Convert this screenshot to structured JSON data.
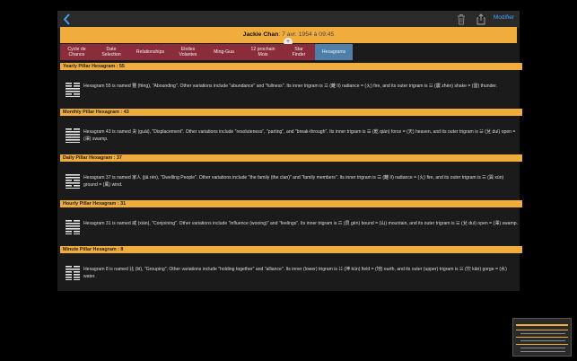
{
  "toolbar": {
    "back_icon": "chevron-left-icon",
    "trash_icon": "trash-icon",
    "share_icon": "share-icon",
    "modifier_label": "Modifier",
    "accent": "#4aa3ff"
  },
  "banner": {
    "name": "Jackie Chan",
    "date": ": 7 avr. 1954 à 09:45",
    "color": "#f0ad3d"
  },
  "plus_label": "+",
  "tabs": [
    {
      "label": "Cycle de\nChance"
    },
    {
      "label": "Date\nSelection"
    },
    {
      "label": "Relationships"
    },
    {
      "label": "Etoiles\nVolantes"
    },
    {
      "label": "Ming-Gua"
    },
    {
      "label": "12 prochain\nMois"
    },
    {
      "label": "Star\nFinder"
    },
    {
      "label": "Hexagrams"
    }
  ],
  "tab_colors": {
    "normal": "#8a2c3a",
    "active": "#4e7fa8"
  },
  "sections": [
    {
      "title": "Yearly Pillar Hexagram : 55",
      "text": "Hexagram 55 is named 豐 (fēng), \"Abounding\". Other variations include \"abundance\" and \"fullness\". Its inner trigram is ☲ (離 lí) radiance = (火) fire, and its outer trigram is ☳ (震 zhèn) shake = (雷) thunder."
    },
    {
      "title": "Monthly Pillar Hexagram : 43",
      "text": "Hexagram 43 is named 夬 (guài), \"Displacement\". Other variations include \"resoluteness\", \"parting\", and \"break-through\". Its inner trigram is ☰ (乾 qián) force = (天) heaven, and its outer trigram is ☱ (兌 duì) open = (澤) swamp."
    },
    {
      "title": "Daily Pillar Hexagram : 37",
      "text": "Hexagram 37 is named 家人 (jiā rén), \"Dwelling People\". Other variations include \"the family (the clan)\" and \"family members\". Its inner trigram is ☲ (離 lí) radiance = (火) fire, and its outer trigram is ☴ (巽 xùn) ground = (風) wind."
    },
    {
      "title": "Hourly Pillar Hexagram : 31",
      "text": "Hexagram 31 is named 咸 (xián), \"Conjoining\". Other variations include \"influence (wooing)\" and \"feelings\". Its inner trigram is ☶ (艮 gèn) bound = (山) mountain, and its outer trigram is ☱ (兌 duì) open = (澤) swamp."
    },
    {
      "title": "Minute Pillar Hexagram : 8",
      "text": "Hexagram 8 is named 比 (bǐ), \"Grouping\". Other variations include \"holding together\" and \"alliance\". Its inner (lower) trigram is ☷ (坤 kūn) field = (地) earth, and its outer (upper) trigram is ☵ (坎 kǎn) gorge = (水) water."
    }
  ],
  "hexagram_icon": "hexagram-lines-icon"
}
